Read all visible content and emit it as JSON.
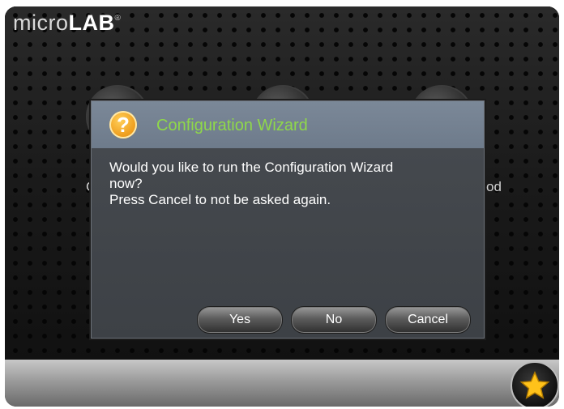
{
  "app": {
    "logo_light": "micro",
    "logo_bold": "LAB",
    "logo_mark": "®"
  },
  "background": {
    "partial_label_left": "C",
    "partial_label_right": "od"
  },
  "dialog": {
    "title": "Configuration Wizard",
    "icon": "help-icon",
    "icon_glyph": "?",
    "message_line_1": "Would you like to run the Configuration Wizard",
    "message_line_2": "now?",
    "message_line_3": "Press Cancel to not be asked again.",
    "buttons": {
      "yes": "Yes",
      "no": "No",
      "cancel": "Cancel"
    }
  },
  "toolbar": {
    "favorite_icon": "star-icon"
  },
  "colors": {
    "title_green": "#8fd84a",
    "header_blue_gray": "#7b8898",
    "icon_orange": "#f0a020",
    "star_yellow": "#ffc21a"
  }
}
